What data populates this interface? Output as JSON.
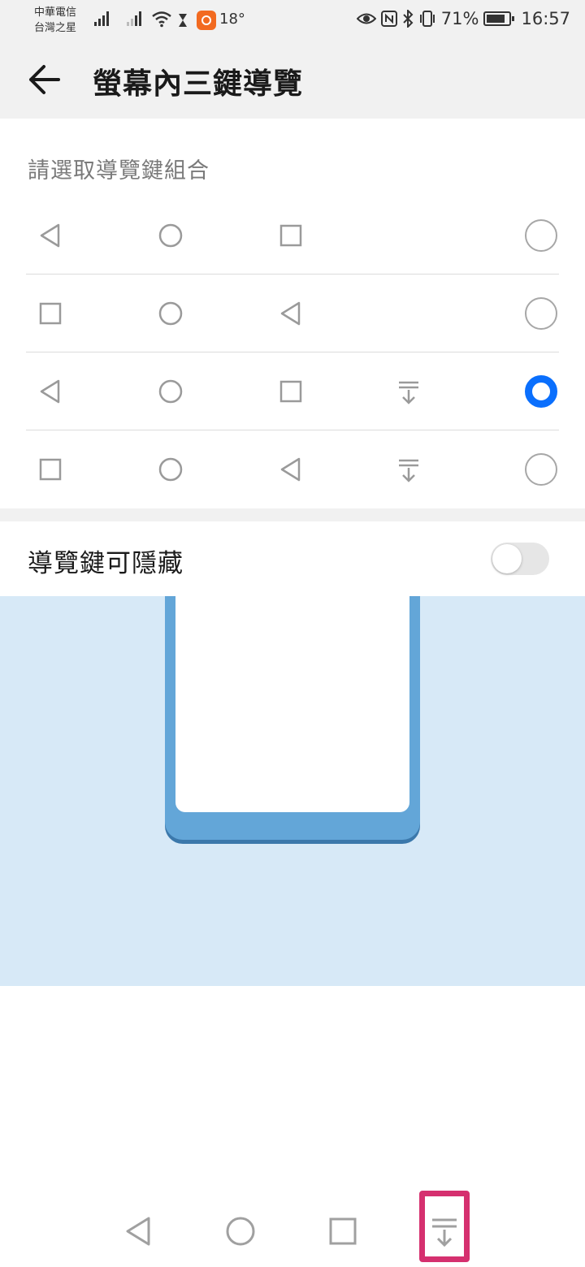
{
  "status_bar": {
    "carrier_line1": "中華電信",
    "carrier_line2": "台灣之星",
    "temperature": "18°",
    "battery_percent": "71%",
    "time": "16:57"
  },
  "header": {
    "title": "螢幕內三鍵導覽"
  },
  "section": {
    "label": "請選取導覽鍵組合"
  },
  "combinations": [
    {
      "keys": [
        "back-icon",
        "home-icon",
        "recents-icon"
      ],
      "selected": false
    },
    {
      "keys": [
        "recents-icon",
        "home-icon",
        "back-icon"
      ],
      "selected": false
    },
    {
      "keys": [
        "back-icon",
        "home-icon",
        "recents-icon",
        "hide-nav-icon"
      ],
      "selected": true
    },
    {
      "keys": [
        "recents-icon",
        "home-icon",
        "back-icon",
        "hide-nav-icon"
      ],
      "selected": false
    }
  ],
  "hide_option": {
    "label": "導覽鍵可隱藏",
    "enabled": false
  },
  "colors": {
    "accent": "#0A6FFD",
    "highlight": "#D5306F",
    "illustration_bg": "#D7E9F7",
    "phone_frame": "#63A6D8"
  },
  "nav_bar": {
    "keys": [
      "back-icon",
      "home-icon",
      "recents-icon",
      "hide-nav-icon"
    ]
  }
}
